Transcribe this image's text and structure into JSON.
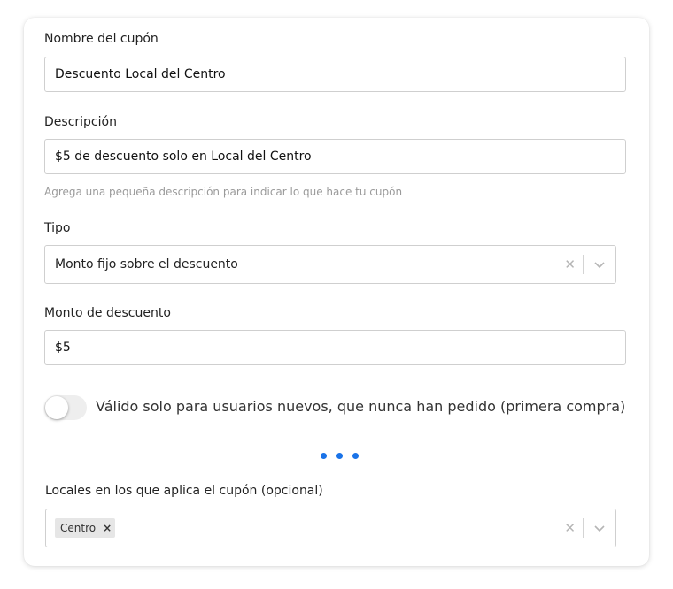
{
  "coupon_name": {
    "label": "Nombre del cupón",
    "value": "Descuento Local del Centro"
  },
  "description": {
    "label": "Descripción",
    "value": "$5 de descuento solo en Local del Centro",
    "helper": "Agrega una pequeña descripción para indicar lo que hace tu cupón"
  },
  "type": {
    "label": "Tipo",
    "value": "Monto fijo sobre el descuento",
    "clear_glyph": "✕"
  },
  "discount_amount": {
    "label": "Monto de descuento",
    "value": "$5"
  },
  "new_users_toggle": {
    "label": "Válido solo para usuarios nuevos, que nunca han pedido (primera compra)",
    "checked": false
  },
  "locations": {
    "label": "Locales en los que aplica el cupón (opcional)",
    "chips": [
      {
        "label": "Centro",
        "remove_glyph": "×"
      }
    ],
    "clear_glyph": "✕"
  },
  "colors": {
    "accent": "#1a73e8",
    "border": "#cfcfcf",
    "helper_text": "#9a9a9a"
  },
  "icons": {
    "more": "more-dots-icon",
    "chevron": "chevron-down-icon",
    "clear": "close-icon"
  }
}
